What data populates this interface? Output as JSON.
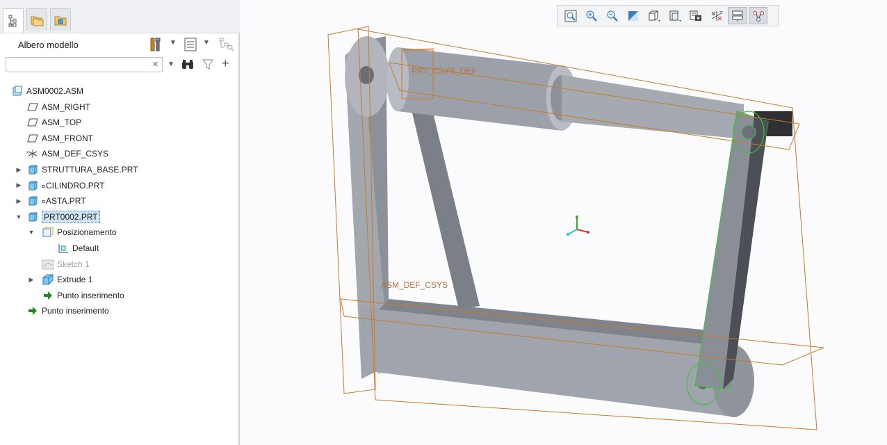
{
  "tabs": [
    {
      "name": "model-tree",
      "icon": "model-tree-icon",
      "active": true
    },
    {
      "name": "folder-browser",
      "icon": "folder-browser-icon",
      "active": false
    },
    {
      "name": "favorites",
      "icon": "favorites-icon",
      "active": false
    }
  ],
  "panel": {
    "title": "Albero modello",
    "search_value": "",
    "search_placeholder": "",
    "clear_label": "×"
  },
  "tree": [
    {
      "label": "ASM0002.ASM",
      "icon": "assembly-icon",
      "level": 0,
      "expander": "none"
    },
    {
      "label": "ASM_RIGHT",
      "icon": "datum-plane-icon",
      "level": 1,
      "expander": "none"
    },
    {
      "label": "ASM_TOP",
      "icon": "datum-plane-icon",
      "level": 1,
      "expander": "none"
    },
    {
      "label": "ASM_FRONT",
      "icon": "datum-plane-icon",
      "level": 1,
      "expander": "none"
    },
    {
      "label": "ASM_DEF_CSYS",
      "icon": "csys-icon",
      "level": 1,
      "expander": "none"
    },
    {
      "label": "STRUTTURA_BASE.PRT",
      "icon": "part-icon",
      "level": 1,
      "expander": "collapsed"
    },
    {
      "label": "CILINDRO.PRT",
      "icon": "part-icon",
      "level": 1,
      "expander": "collapsed",
      "prefix": "¤"
    },
    {
      "label": "ASTA.PRT",
      "icon": "part-icon",
      "level": 1,
      "expander": "collapsed",
      "prefix": "¤"
    },
    {
      "label": "PRT0002.PRT",
      "icon": "part-icon",
      "level": 1,
      "expander": "expanded",
      "selected": true
    },
    {
      "label": "Posizionamento",
      "icon": "placement-icon",
      "level": 2,
      "expander": "expanded"
    },
    {
      "label": "Default",
      "icon": "default-constraint-icon",
      "level": 3,
      "expander": "none"
    },
    {
      "label": "Sketch 1",
      "icon": "sketch-icon",
      "level": 2,
      "expander": "none",
      "dim": true
    },
    {
      "label": "Extrude 1",
      "icon": "extrude-icon",
      "level": 2,
      "expander": "collapsed"
    },
    {
      "label": "Punto inserimento",
      "icon": "insert-here-icon",
      "level": 2,
      "expander": "none"
    },
    {
      "label": "Punto inserimento",
      "icon": "insert-here-icon",
      "level": 1,
      "expander": "none"
    }
  ],
  "graphics_toolbar": [
    {
      "name": "refit",
      "icon": "refit-icon"
    },
    {
      "name": "zoom-in",
      "icon": "zoom-in-icon"
    },
    {
      "name": "zoom-out",
      "icon": "zoom-out-icon"
    },
    {
      "name": "repaint",
      "icon": "repaint-icon"
    },
    {
      "name": "display-style",
      "icon": "display-style-icon"
    },
    {
      "name": "saved-orientations",
      "icon": "saved-orientations-icon"
    },
    {
      "name": "view-manager",
      "icon": "view-manager-icon"
    },
    {
      "name": "datum-display-filters",
      "icon": "datum-display-filters-icon"
    },
    {
      "name": "annotation-display",
      "icon": "annotation-display-icon",
      "active": true
    },
    {
      "name": "spin-center",
      "icon": "spin-center-icon",
      "active": true
    }
  ],
  "model_labels": {
    "top_csys": "PRT_CSYS_DEF",
    "bottom_csys": "ASM_DEF_CSYS"
  },
  "colors": {
    "datum": "#c87a2a",
    "part_fill": "#9ea3ab",
    "selection_green": "#3fbf3f",
    "selection_bg": "#cfe3f7"
  }
}
